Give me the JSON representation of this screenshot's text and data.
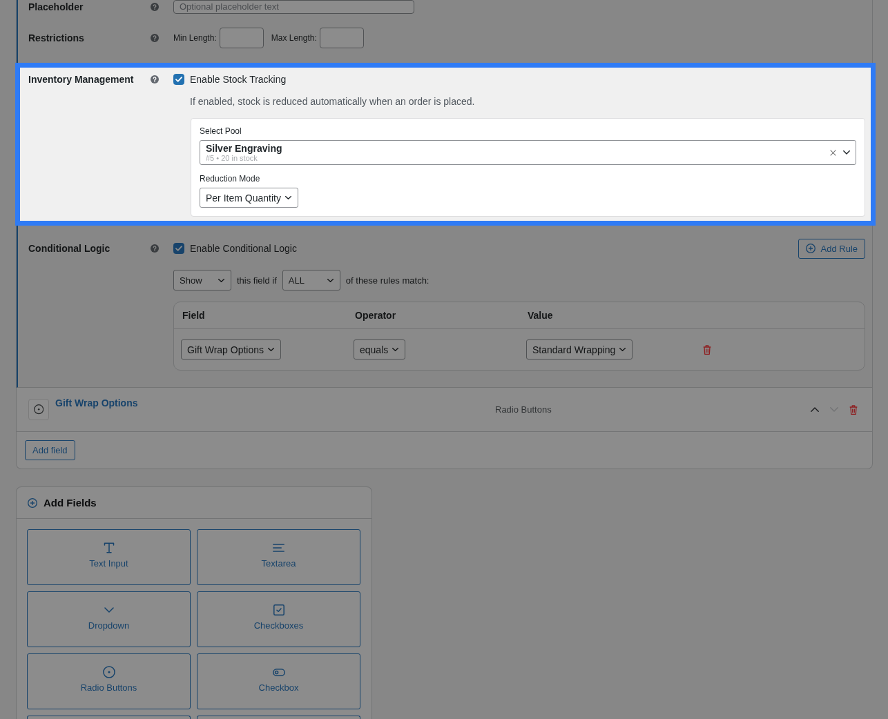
{
  "field_settings": {
    "rows": [
      {
        "kind": "placeholder",
        "label": "Placeholder",
        "highlighted": false,
        "input": {
          "placeholder": "Optional placeholder text"
        }
      },
      {
        "kind": "restrictions",
        "label": "Restrictions",
        "highlighted": false,
        "inputs": [
          {
            "label": "Min Length:"
          },
          {
            "label": "Max Length:"
          }
        ]
      },
      {
        "kind": "inventory",
        "label": "Inventory Management",
        "highlighted": true,
        "checkbox": {
          "label": "Enable Stock Tracking",
          "checked": true
        },
        "description": "If enabled, stock is reduced automatically when an order is placed.",
        "pool": {
          "label": "Select Pool",
          "value": "Silver Engraving",
          "meta": "#5 • 20 in stock"
        },
        "reduction_mode": {
          "label": "Reduction Mode",
          "value": "Per Item Quantity"
        }
      },
      {
        "kind": "conditional",
        "label": "Conditional Logic",
        "highlighted": false,
        "checkbox": {
          "label": "Enable Conditional Logic",
          "checked": true
        },
        "add_rule_button": "Add Rule",
        "action": "Show",
        "connector": "this field if",
        "match": "ALL",
        "suffix": "of these rules match:",
        "rules_table": {
          "columns": [
            "Field",
            "Operator",
            "Value"
          ],
          "rows": [
            {
              "field": "Gift Wrap Options",
              "operator": "equals",
              "value": "Standard Wrapping"
            }
          ]
        }
      }
    ]
  },
  "fields": [
    {
      "kind": "radio",
      "title": "Gift Wrap Options",
      "type": "Radio Buttons",
      "can_move_up": true,
      "can_move_down": false
    }
  ],
  "add_field_button": "Add field",
  "add_fields_panel": {
    "title": "Add Fields",
    "tiles": [
      {
        "kind": "text",
        "label": "Text Input"
      },
      {
        "kind": "textarea",
        "label": "Textarea"
      },
      {
        "kind": "dropdown",
        "label": "Dropdown"
      },
      {
        "kind": "checkboxes",
        "label": "Checkboxes"
      },
      {
        "kind": "radio",
        "label": "Radio Buttons"
      },
      {
        "kind": "toggle",
        "label": "Checkbox"
      },
      {
        "kind": "offscreen"
      },
      {
        "kind": "offscreen"
      }
    ]
  }
}
